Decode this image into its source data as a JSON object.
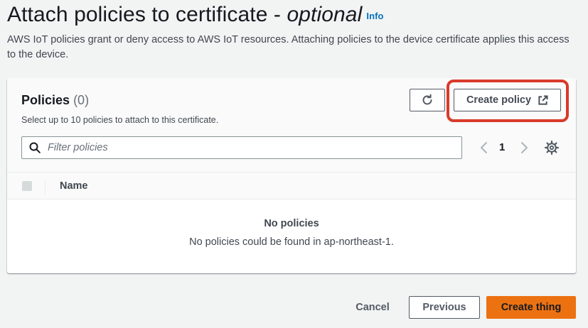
{
  "page": {
    "title_main": "Attach policies to certificate - ",
    "title_optional": "optional",
    "info_label": "Info",
    "description": "AWS IoT policies grant or deny access to AWS IoT resources. Attaching policies to the device certificate applies this access to the device."
  },
  "policies_panel": {
    "title": "Policies",
    "count": "(0)",
    "description": "Select up to 10 policies to attach to this certificate.",
    "create_policy_label": "Create policy",
    "filter_placeholder": "Filter policies",
    "current_page": "1",
    "column_name": "Name",
    "empty_title": "No policies",
    "empty_description": "No policies could be found in ap-northeast-1."
  },
  "footer": {
    "cancel_label": "Cancel",
    "previous_label": "Previous",
    "create_thing_label": "Create thing"
  },
  "icons": {
    "refresh": "refresh-icon",
    "external_link": "external-link-icon",
    "search": "search-icon",
    "prev_page": "chevron-left-icon",
    "next_page": "chevron-right-icon",
    "settings": "gear-icon"
  },
  "colors": {
    "primary_button": "#ec7211",
    "link": "#0073bb",
    "highlight": "#d93a2b"
  }
}
